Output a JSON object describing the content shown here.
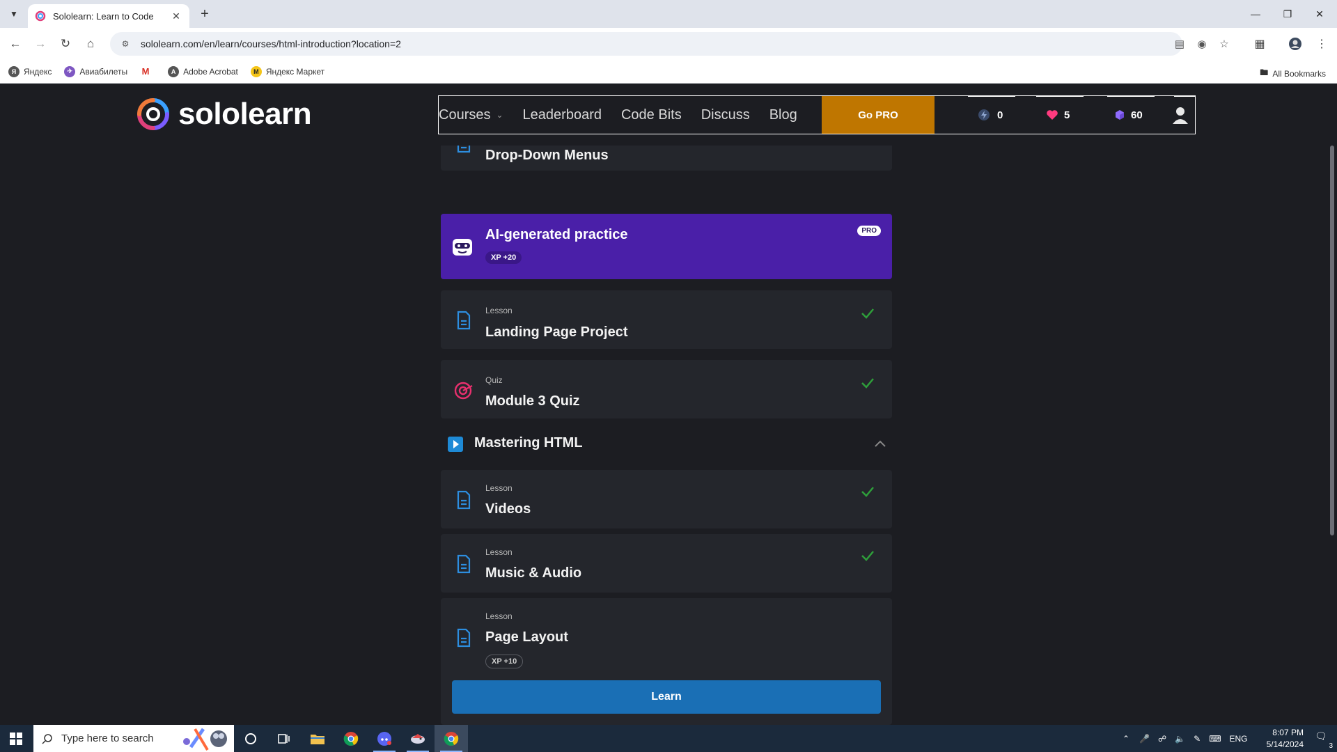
{
  "browser": {
    "tab_title": "Sololearn: Learn to Code",
    "url": "sololearn.com/en/learn/courses/html-introduction?location=2",
    "bookmarks": [
      {
        "label": "Яндекс",
        "color": "#555555"
      },
      {
        "label": "Авиабилеты",
        "color": "#7e57c2"
      },
      {
        "label": "",
        "color": "#d93025"
      },
      {
        "label": "Adobe Acrobat",
        "color": "#555555"
      },
      {
        "label": "Яндекс Маркет",
        "color": "#f5c518"
      }
    ],
    "all_bookmarks": "All Bookmarks"
  },
  "header": {
    "logo_text": "sololearn",
    "nav": {
      "courses": "Courses",
      "leaderboard": "Leaderboard",
      "code_bits": "Code Bits",
      "discuss": "Discuss",
      "blog": "Blog"
    },
    "go_pro": "Go PRO",
    "streak": "0",
    "hearts": "5",
    "bits": "60"
  },
  "course": {
    "items": [
      {
        "kind": "Lesson",
        "title": "Drop-Down Menus",
        "completed": true
      },
      {
        "title": "AI-generated practice",
        "badge": "PRO",
        "xp": "XP +20"
      },
      {
        "kind": "Lesson",
        "title": "Landing Page Project",
        "completed": true
      },
      {
        "kind": "Quiz",
        "title": "Module 3 Quiz",
        "completed": true
      }
    ],
    "section": {
      "title": "Mastering HTML",
      "expanded": true
    },
    "section_items": [
      {
        "kind": "Lesson",
        "title": "Videos",
        "completed": true
      },
      {
        "kind": "Lesson",
        "title": "Music & Audio",
        "completed": true
      },
      {
        "kind": "Lesson",
        "title": "Page Layout",
        "xp": "XP +10",
        "completed": false
      }
    ],
    "learn_button": "Learn"
  },
  "taskbar": {
    "search_placeholder": "Type here to search",
    "language": "ENG",
    "time": "8:07 PM",
    "date": "5/14/2024",
    "notifications": "3"
  },
  "colors": {
    "accent_blue": "#1a6fb5",
    "pro_orange": "#bf7600",
    "ai_purple": "#4a1fa8",
    "check_green": "#2e9e3a",
    "page_bg": "#1c1d22",
    "card_bg": "#24262c"
  }
}
